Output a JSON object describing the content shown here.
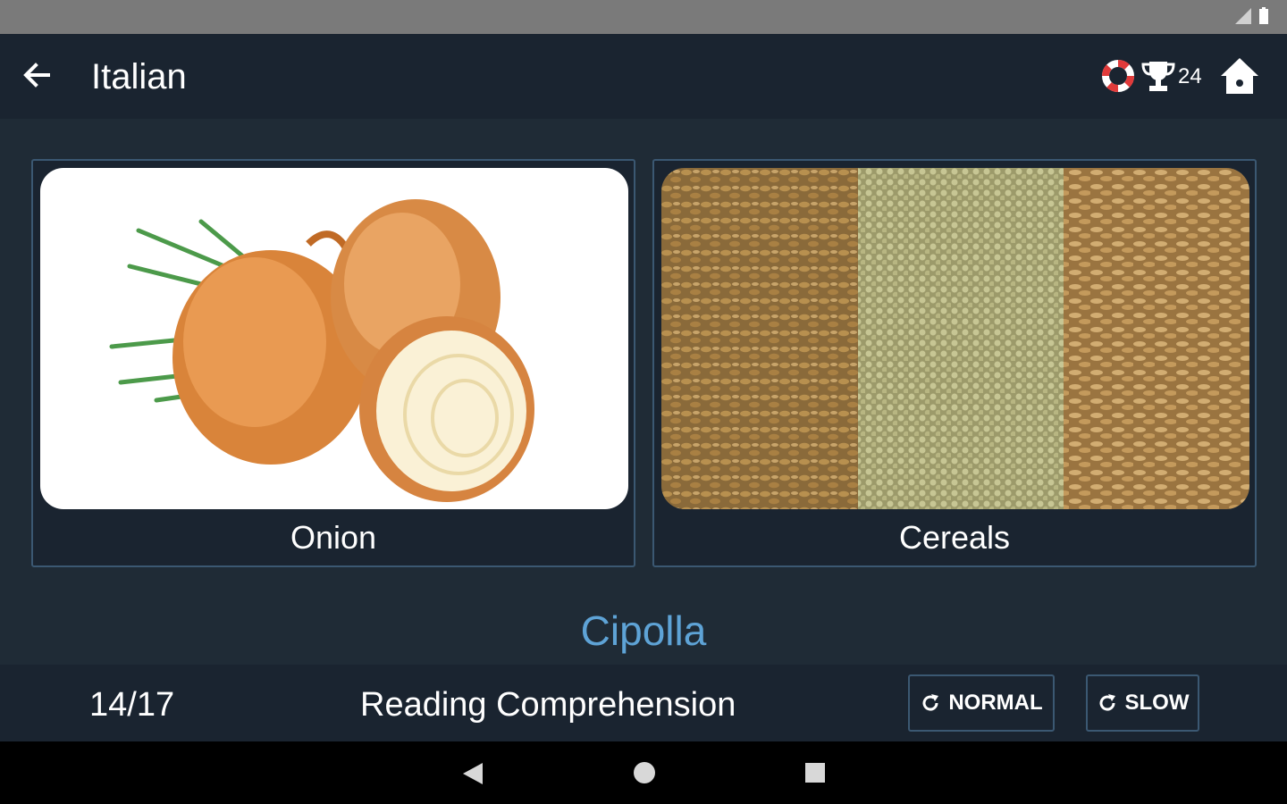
{
  "app": {
    "title": "Italian",
    "score": "24",
    "icons": [
      "back-arrow-icon",
      "lifebuoy-icon",
      "trophy-icon",
      "home-icon"
    ]
  },
  "cards": [
    {
      "label": "Onion",
      "image": "onion-photo"
    },
    {
      "label": "Cereals",
      "image": "cereal-grains-photo"
    }
  ],
  "word": "Cipolla",
  "footer": {
    "progress": "14/17",
    "mode": "Reading Comprehension",
    "normal_label": "NORMAL",
    "slow_label": "SLOW"
  },
  "colors": {
    "background": "#1f2b36",
    "bar": "#1a2430",
    "accent": "#5ea3d6",
    "border": "#3b5872"
  }
}
